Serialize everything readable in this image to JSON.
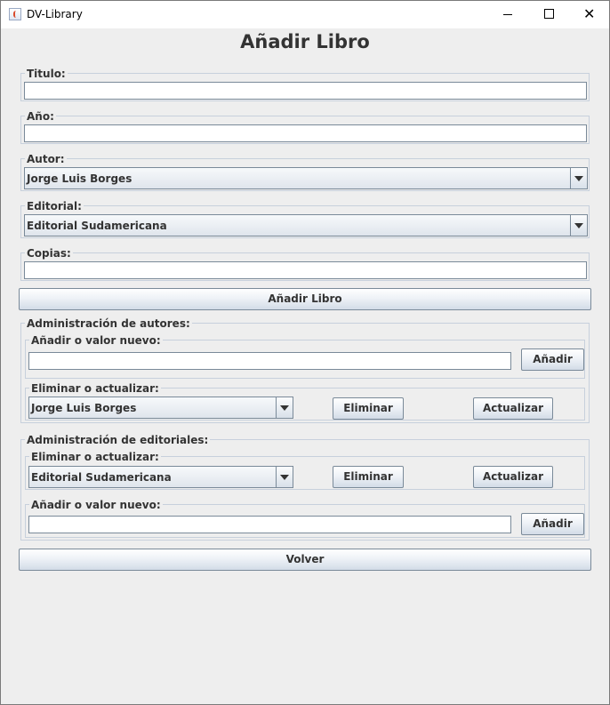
{
  "window": {
    "title": "DV-Library",
    "close_glyph": "✕"
  },
  "heading": "Añadir Libro",
  "form": {
    "titulo_label": "Titulo:",
    "titulo_value": "",
    "anio_label": "Año:",
    "anio_value": "",
    "autor_label": "Autor:",
    "autor_selected": "Jorge Luis Borges",
    "editorial_label": "Editorial:",
    "editorial_selected": "Editorial Sudamericana",
    "copias_label": "Copias:",
    "copias_value": "",
    "submit_label": "Añadir Libro"
  },
  "autores_admin": {
    "title": "Administración de autores:",
    "add_title": "Añadir o valor nuevo:",
    "add_value": "",
    "add_button": "Añadir",
    "edit_title": "Eliminar o actualizar:",
    "selected": "Jorge Luis Borges",
    "delete_button": "Eliminar",
    "update_button": "Actualizar"
  },
  "editoriales_admin": {
    "title": "Administración de editoriales:",
    "edit_title": "Eliminar o actualizar:",
    "selected": "Editorial Sudamericana",
    "delete_button": "Eliminar",
    "update_button": "Actualizar",
    "add_title": "Añadir o valor nuevo:",
    "add_value": "",
    "add_button": "Añadir"
  },
  "back_button": "Volver",
  "icons": {
    "app": "java-app-icon",
    "minimize": "minimize-icon",
    "maximize": "maximize-icon",
    "close": "close-icon",
    "dropdown": "chevron-down-icon"
  }
}
